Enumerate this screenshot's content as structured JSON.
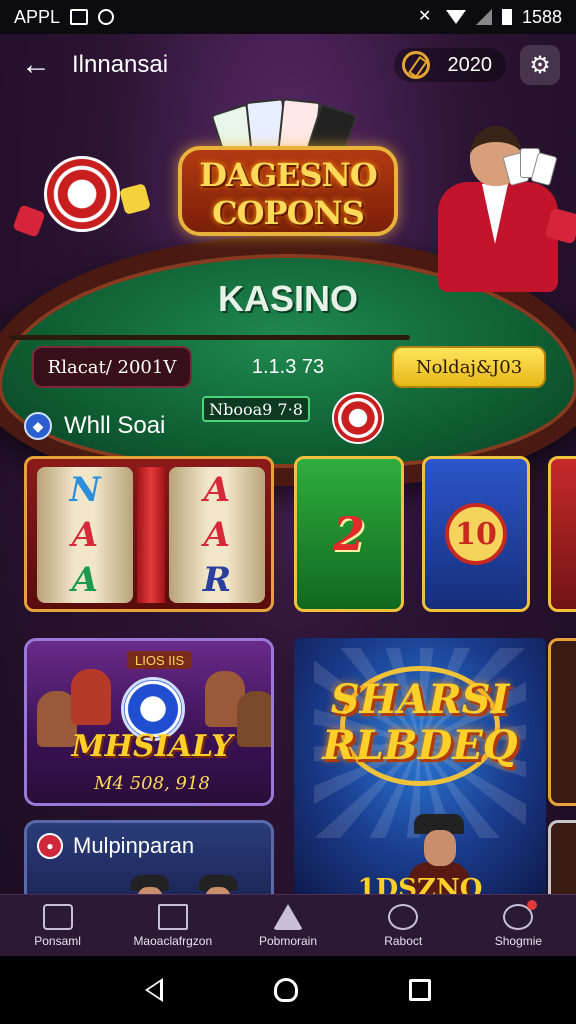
{
  "status_bar": {
    "left_label": "APPL",
    "time": "1588"
  },
  "topbar": {
    "title": "Ilnnansai",
    "coins": "2020"
  },
  "hero": {
    "logo_line1": "DAGESNO",
    "logo_line2": "COPONS",
    "table_label": "KASINO",
    "stat_left": "Rlacat/ 2001V",
    "stat_mid": "1.1.3 73",
    "stat_button": "Noldaj&J03",
    "promo_code": "Nbooa9 7·8"
  },
  "section": {
    "title": "Whll Soai"
  },
  "games": {
    "reel1": [
      "N",
      "A",
      "A"
    ],
    "reel2": [
      "A",
      "A",
      "R"
    ],
    "green_tile_label": "2",
    "blue_tile_label": "10"
  },
  "promos": {
    "card_badge": "LIOS IIS",
    "card_title": "MHSIALY",
    "card_sub": "M4 508, 918",
    "multi_title": "Mulpinparan",
    "big_title_1": "SHARSI",
    "big_title_2": "RLBDEQ",
    "big_bottom": "1DSZNQ"
  },
  "bottom_nav": [
    {
      "label": "Ponsaml",
      "icon": "bookmark-icon"
    },
    {
      "label": "Maoaclafrgzon",
      "icon": "home-icon"
    },
    {
      "label": "Pobmorain",
      "icon": "star-icon"
    },
    {
      "label": "Raboct",
      "icon": "search-icon"
    },
    {
      "label": "Shogmie",
      "icon": "profile-icon"
    }
  ]
}
